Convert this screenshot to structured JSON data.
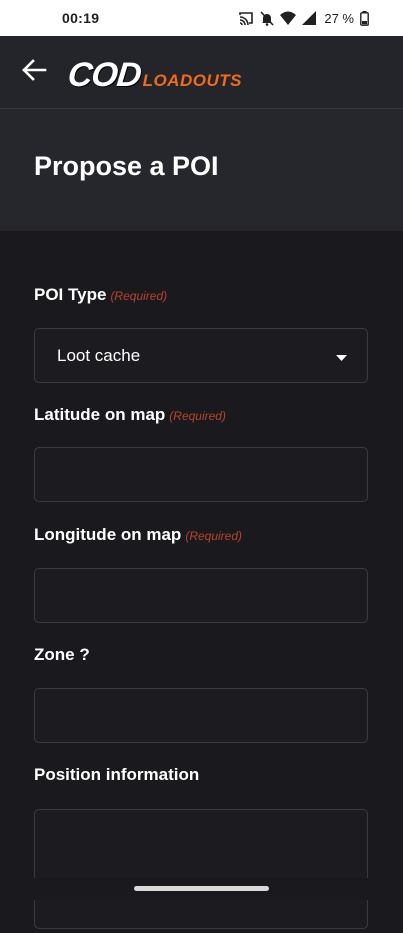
{
  "status_bar": {
    "time": "00:19",
    "battery_text": "27 %",
    "icons": [
      "cast-icon",
      "bell-off-icon",
      "wifi-icon",
      "signal-icon",
      "battery-icon"
    ]
  },
  "header": {
    "back_icon": "arrow-left-icon",
    "logo_main": "COD",
    "logo_sub": "LOADOUTS",
    "logo_accent_color": "#f26b1d"
  },
  "page": {
    "title": "Propose a POI"
  },
  "form": {
    "required_label": "(Required)",
    "poi_type": {
      "label": "POI Type",
      "value": "Loot cache"
    },
    "latitude": {
      "label": "Latitude on map",
      "value": ""
    },
    "longitude": {
      "label": "Longitude on map",
      "value": ""
    },
    "zone": {
      "label": "Zone ?",
      "value": ""
    },
    "position": {
      "label": "Position information",
      "value": ""
    }
  },
  "colors": {
    "background": "#1a1a1e",
    "header": "#24252b",
    "required": "#b8432b"
  }
}
